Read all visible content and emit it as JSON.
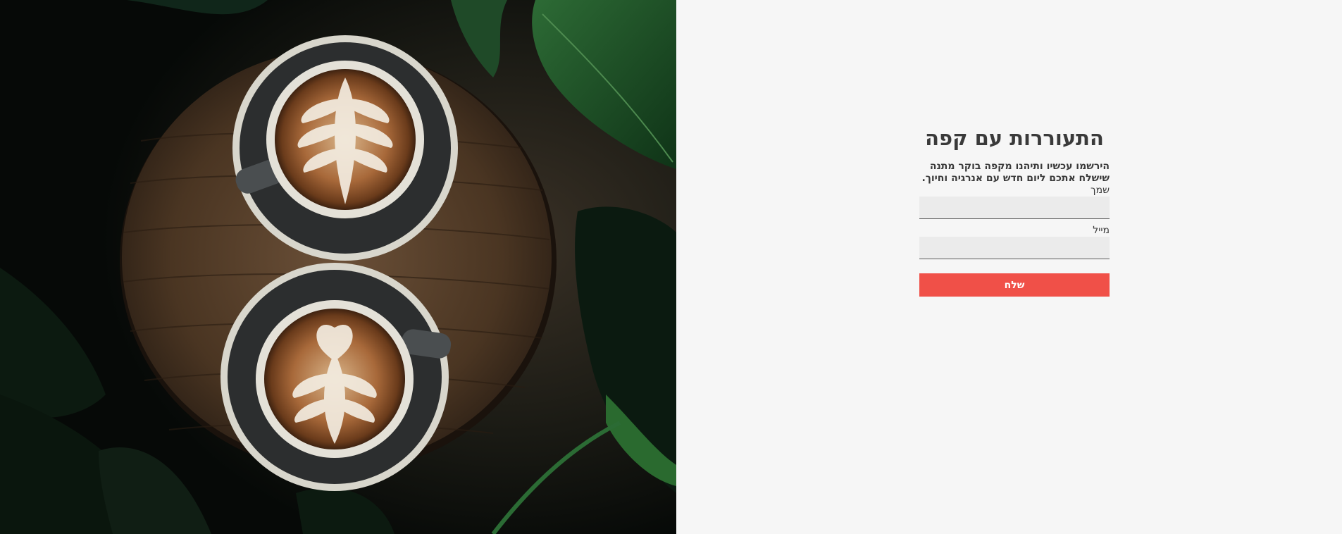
{
  "hero": {
    "image_description_icon": "coffee-cups-photo"
  },
  "form": {
    "title": "התעוררות עם קפה",
    "subtitle": "הירשמו עכשיו ותיהנו מקפה בוקר מתנה שישלח אתכם ליום חדש עם אנרגיה וחיוך.",
    "name_label": "שמך",
    "name_value": "",
    "email_label": "מייל",
    "email_value": "",
    "submit_label": "שלח"
  },
  "colors": {
    "panel_background": "#f6f6f6",
    "button_background": "#f05048",
    "field_background": "#ebebeb",
    "text": "#3a3a3a"
  }
}
